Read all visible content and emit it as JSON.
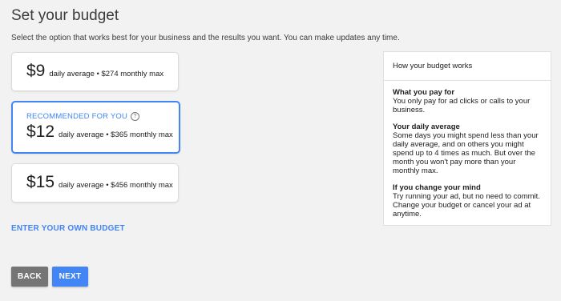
{
  "page": {
    "title": "Set your budget",
    "subtitle": "Select the option that works best for your business and the results you want. You can make updates any time."
  },
  "options": [
    {
      "price": "$9",
      "detail": "daily average • $274 monthly max",
      "selected": false
    },
    {
      "label": "RECOMMENDED FOR YOU",
      "help_icon": "?",
      "price": "$12",
      "detail": "daily average • $365 monthly max",
      "selected": true
    },
    {
      "price": "$15",
      "detail": "daily average • $456 monthly max",
      "selected": false
    }
  ],
  "own_budget_link": "ENTER YOUR OWN BUDGET",
  "buttons": {
    "back": "BACK",
    "next": "NEXT"
  },
  "info_panel": {
    "title": "How your budget works",
    "sections": [
      {
        "heading": "What you pay for",
        "text": "You only pay for ad clicks or calls to your business."
      },
      {
        "heading": "Your daily average",
        "text": "Some days you might spend less than your daily average, and on others you might spend up to 4 times as much. But over the month you won't pay more than your monthly max."
      },
      {
        "heading": "If you change your mind",
        "text": "Try running your ad, but no need to commit. Change your budget or cancel your ad at anytime."
      }
    ]
  },
  "colors": {
    "accent": "#4285f4",
    "back_button": "#757575",
    "background": "#f2f2f2"
  }
}
